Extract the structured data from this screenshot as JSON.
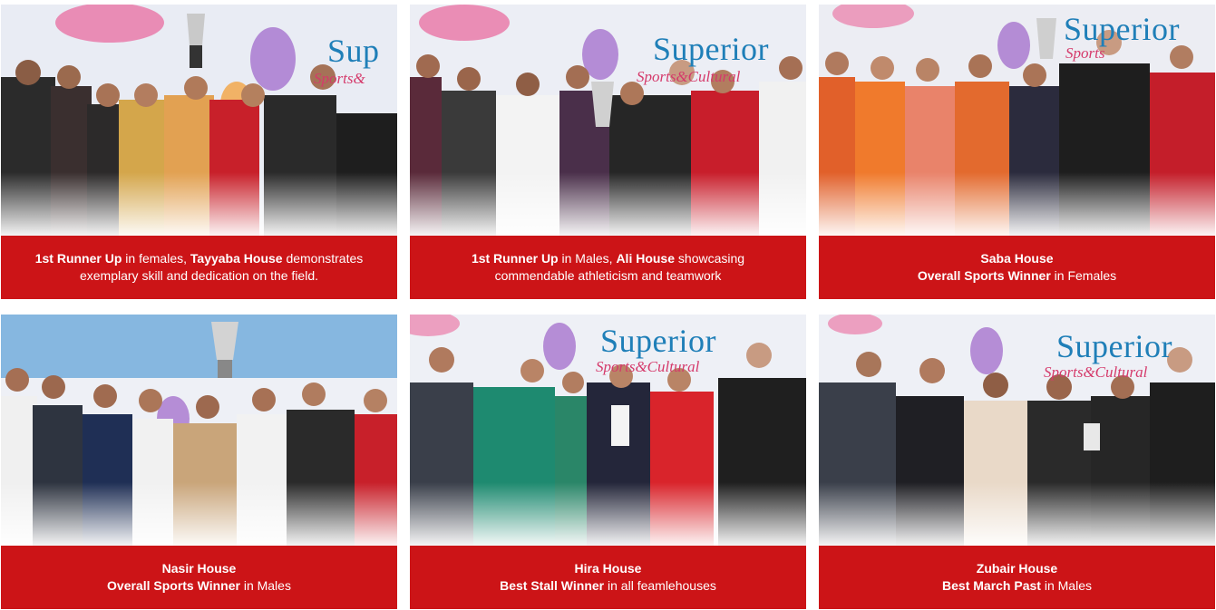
{
  "cards": [
    {
      "caption": {
        "line1_bold": "1st Runner Up",
        "line1_rest": " in females, ",
        "line1_bold2": "Tayyaba House",
        "line1_rest2": " demonstrates",
        "line2": "exemplary skill and dedication on the field."
      },
      "photo_banner": {
        "word1": "Sup",
        "word2": "Sports&"
      }
    },
    {
      "caption": {
        "line1_bold": "1st Runner Up",
        "line1_rest": " in Males, ",
        "line1_bold2": "Ali House",
        "line1_rest2": " showcasing",
        "line2": "commendable athleticism and teamwork"
      },
      "photo_banner": {
        "word1": "Superior",
        "word2": "Sports&Cultural"
      }
    },
    {
      "caption": {
        "title": "Saba House",
        "award_bold": "Overall Sports Winner",
        "award_rest": " in Females"
      },
      "photo_banner": {
        "word1": "Superior",
        "word2": "Sports"
      }
    },
    {
      "caption": {
        "title": "Nasir House",
        "award_bold": "Overall Sports Winner",
        "award_rest": " in Males"
      },
      "photo_banner": {
        "word1": "",
        "word2": ""
      }
    },
    {
      "caption": {
        "title": "Hira House",
        "award_bold": "Best Stall Winner",
        "award_rest": " in all feamlehouses"
      },
      "photo_banner": {
        "word1": "Superior",
        "word2": "Sports&Cultural"
      }
    },
    {
      "caption": {
        "title": "Zubair House",
        "award_bold": "Best March Past",
        "award_rest": " in Males"
      },
      "photo_banner": {
        "word1": "Superior",
        "word2": "Sports&Cultural"
      }
    }
  ],
  "colors": {
    "caption_bg": "#cc1417",
    "caption_text": "#ffffff",
    "brand_blue": "#1f7fb8",
    "brand_pink": "#d53a6b"
  }
}
